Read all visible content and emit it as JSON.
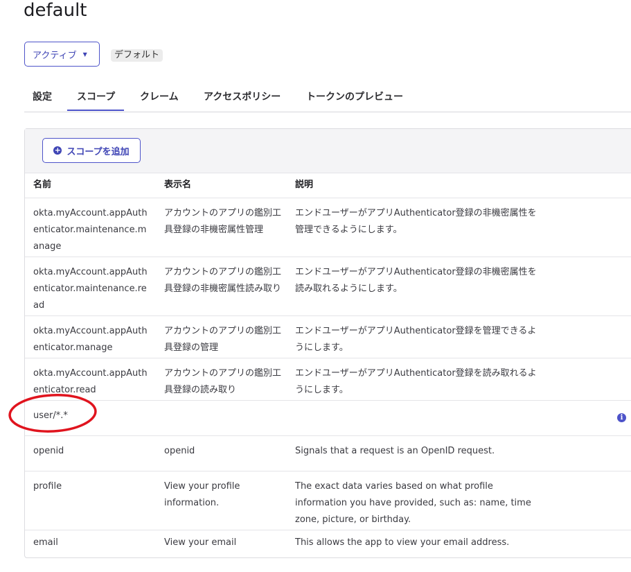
{
  "page": {
    "title": "default"
  },
  "status": {
    "label": "アクティブ",
    "caret": "▼"
  },
  "badge": {
    "label": "デフォルト"
  },
  "tabs": [
    {
      "label": "設定"
    },
    {
      "label": "スコープ",
      "active": true
    },
    {
      "label": "クレーム"
    },
    {
      "label": "アクセスポリシー"
    },
    {
      "label": "トークンのプレビュー"
    }
  ],
  "toolbar": {
    "add_scope_label": "スコープを追加"
  },
  "table": {
    "headers": [
      "名前",
      "表示名",
      "説明"
    ],
    "rows": [
      {
        "name": "okta.myAccount.appAuthenticator.maintenance.manage",
        "display": "アカウントのアプリの鑑別工具登録の非機密属性管理",
        "desc": "エンドユーザーがアプリAuthenticator登録の非機密属性を管理できるようにします。"
      },
      {
        "name": "okta.myAccount.appAuthenticator.maintenance.read",
        "display": "アカウントのアプリの鑑別工具登録の非機密属性読み取り",
        "desc": "エンドユーザーがアプリAuthenticator登録の非機密属性を読み取れるようにします。"
      },
      {
        "name": "okta.myAccount.appAuthenticator.manage",
        "display": "アカウントのアプリの鑑別工具登録の管理",
        "desc": "エンドユーザーがアプリAuthenticator登録を管理できるようにします。"
      },
      {
        "name": "okta.myAccount.appAuthenticator.read",
        "display": "アカウントのアプリの鑑別工具登録の読み取り",
        "desc": "エンドユーザーがアプリAuthenticator登録を読み取れるようにします。"
      },
      {
        "name": "user/*.*",
        "display": "",
        "desc": ""
      },
      {
        "name": "openid",
        "display": "openid",
        "desc": "Signals that a request is an OpenID request."
      },
      {
        "name": "profile",
        "display": "View your profile information.",
        "desc": "The exact data varies based on what profile information you have provided, such as: name, time zone, picture, or birthday."
      },
      {
        "name": "email",
        "display": "View your email",
        "desc": "This allows the app to view your email address."
      }
    ]
  },
  "colors": {
    "accent": "#4d53c9",
    "annotation": "#e0141e"
  },
  "icons": {
    "info": "info-icon",
    "add": "plus-circle-icon",
    "caret": "caret-down-icon"
  }
}
